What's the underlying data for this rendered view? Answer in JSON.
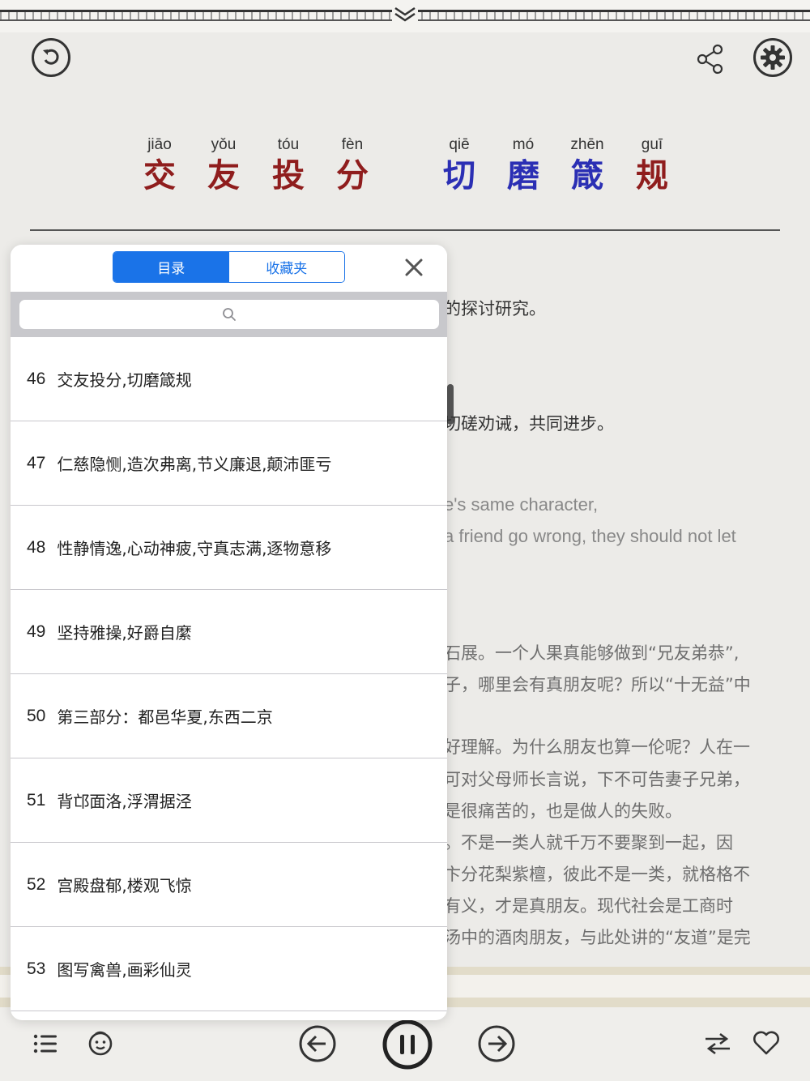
{
  "title": {
    "chars": [
      {
        "pinyin": "jiāo",
        "hanzi": "交",
        "color": "red"
      },
      {
        "pinyin": "yǒu",
        "hanzi": "友",
        "color": "red"
      },
      {
        "pinyin": "tóu",
        "hanzi": "投",
        "color": "red"
      },
      {
        "pinyin": "fèn",
        "hanzi": "分",
        "color": "red"
      },
      {
        "pinyin": "qiē",
        "hanzi": "切",
        "color": "blue"
      },
      {
        "pinyin": "mó",
        "hanzi": "磨",
        "color": "blue"
      },
      {
        "pinyin": "zhēn",
        "hanzi": "箴",
        "color": "blue"
      },
      {
        "pinyin": "guī",
        "hanzi": "规",
        "color": "red"
      }
    ]
  },
  "background_text": {
    "line1": "的探讨研究。",
    "line2": "切磋劝诫，共同进步。",
    "line3": "e's same character,",
    "line4": "a friend go wrong, they should not let",
    "line5": "石展。一个人果真能够做到“兄友弟恭”,",
    "line6": "子，哪里会有真朋友呢？所以“十无益”中",
    "line7": "好理解。为什么朋友也算一伦呢？人在一",
    "line8": "可对父母师长言说，下不可告妻子兄弟，",
    "line9": "是很痛苦的，也是做人的失败。",
    "line10": "。不是一类人就千万不要聚到一起，因",
    "line11": "卞分花梨紫檀，彼此不是一类，就格格不",
    "line12": "有义，才是真朋友。现代社会是工商时",
    "line13": "汤中的酒肉朋友，与此处讲的“友道”是完"
  },
  "panel": {
    "tabs": [
      "目录",
      "收藏夹"
    ],
    "active_tab": 0,
    "search_placeholder": "",
    "items": [
      {
        "num": "46",
        "label": "交友投分,切磨箴规"
      },
      {
        "num": "47",
        "label": "仁慈隐恻,造次弗离,节义廉退,颠沛匪亏"
      },
      {
        "num": "48",
        "label": "性静情逸,心动神疲,守真志满,逐物意移"
      },
      {
        "num": "49",
        "label": "坚持雅操,好爵自縻"
      },
      {
        "num": "50",
        "label": "第三部分：都邑华夏,东西二京"
      },
      {
        "num": "51",
        "label": "背邙面洛,浮渭据泾"
      },
      {
        "num": "52",
        "label": "宫殿盘郁,楼观飞惊"
      },
      {
        "num": "53",
        "label": "图写禽兽,画彩仙灵"
      }
    ]
  },
  "colors": {
    "accent": "#1a73e8",
    "title_red": "#8f1d1d",
    "title_blue": "#2b2fb4"
  }
}
